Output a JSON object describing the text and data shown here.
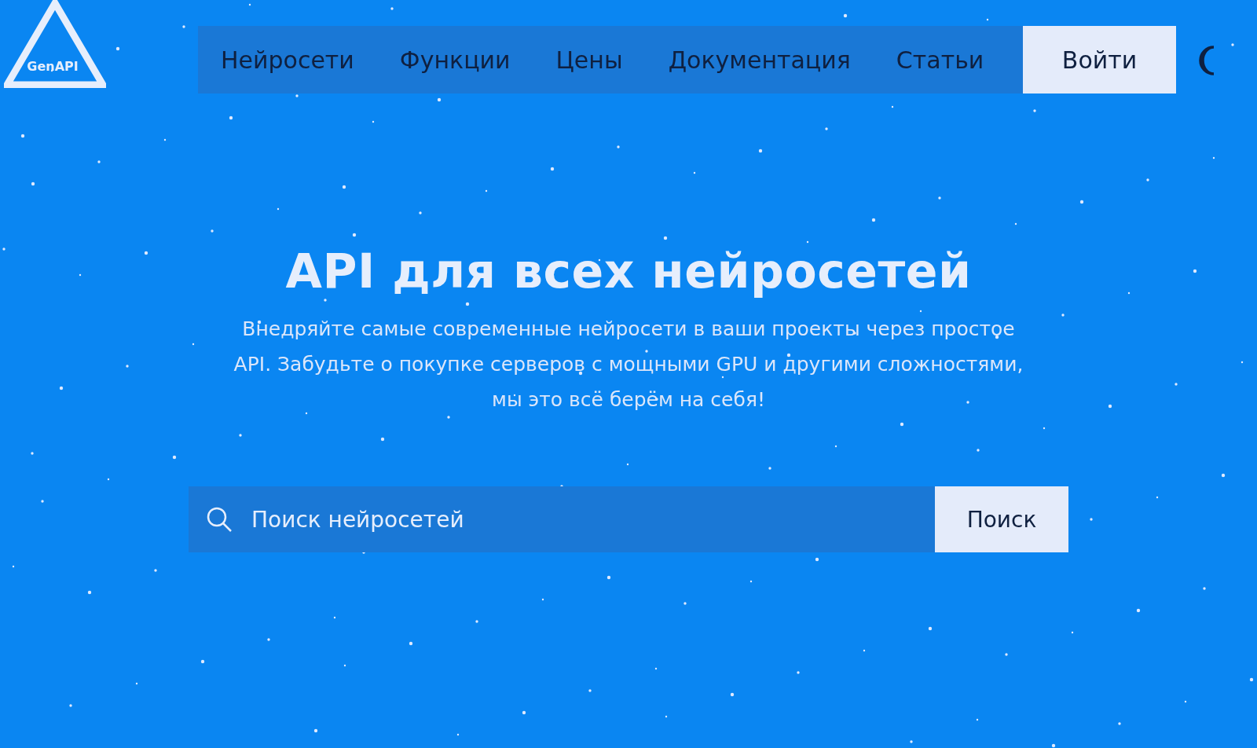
{
  "logo": {
    "text": "GenAPI"
  },
  "nav": {
    "items": [
      {
        "label": "Нейросети"
      },
      {
        "label": "Функции"
      },
      {
        "label": "Цены"
      },
      {
        "label": "Документация"
      },
      {
        "label": "Статьи"
      }
    ],
    "login": "Войти"
  },
  "hero": {
    "title": "API для всех нейросетей",
    "subtitle": "Внедряйте самые современные нейросети в ваши проекты через простое API. Забудьте о покупке серверов с мощными GPU и другими сложностями, мы это всё берём на себя!"
  },
  "search": {
    "placeholder": "Поиск нейросетей",
    "button": "Поиск"
  }
}
